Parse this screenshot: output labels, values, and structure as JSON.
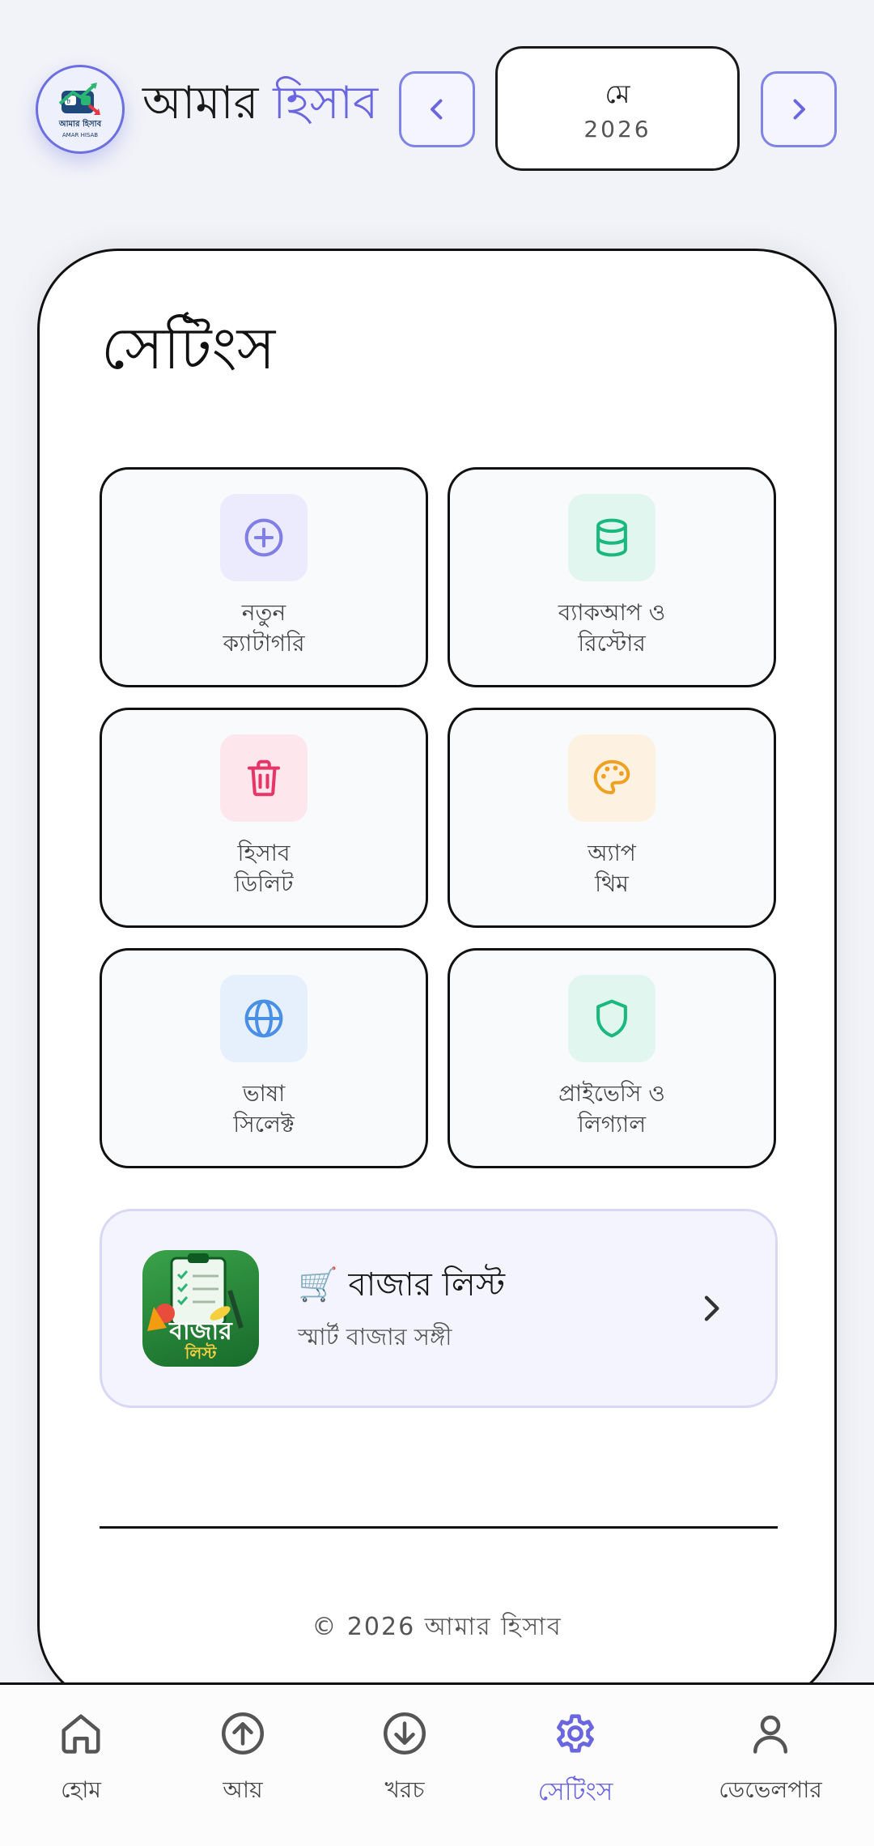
{
  "header": {
    "logo_text": "আমার হিসাব",
    "logo_subtext": "AMAR HISAB",
    "title_part1": "আমার",
    "title_part2": "হিসাব",
    "month": "মে",
    "year": "2026",
    "prev_icon": "chevron-left-icon",
    "next_icon": "chevron-right-icon"
  },
  "settings": {
    "title": "সেটিংস",
    "tiles": [
      {
        "line1": "নতুন",
        "line2": "ক্যাটাগরি",
        "icon": "plus-circle-icon",
        "color": "#7f7fe6",
        "bg": "#ecebfd"
      },
      {
        "line1": "ব্যাকআপ ও",
        "line2": "রিস্টোর",
        "icon": "database-icon",
        "color": "#1ab87e",
        "bg": "#e1f6ee"
      },
      {
        "line1": "হিসাব",
        "line2": "ডিলিট",
        "icon": "trash-icon",
        "color": "#e63566",
        "bg": "#fde6ec"
      },
      {
        "line1": "অ্যাপ",
        "line2": "থিম",
        "icon": "palette-icon",
        "color": "#f0a020",
        "bg": "#fdf1e2"
      },
      {
        "line1": "ভাষা",
        "line2": "সিলেক্ট",
        "icon": "globe-icon",
        "color": "#4a8fe6",
        "bg": "#e6effc"
      },
      {
        "line1": "প্রাইভেসি ও",
        "line2": "লিগ্যাল",
        "icon": "shield-icon",
        "color": "#1ab87e",
        "bg": "#e1f6ee"
      }
    ]
  },
  "promo": {
    "title": "🛒 বাজার লিস্ট",
    "subtitle": "স্মার্ট বাজার সঙ্গী",
    "image_text_1": "বাজার",
    "image_text_2": "লিস্ট"
  },
  "footer": {
    "copyright": "© 2026 আমার হিসাব"
  },
  "bottom_nav": {
    "items": [
      {
        "label": "হোম",
        "icon": "home-icon"
      },
      {
        "label": "আয়",
        "icon": "arrow-up-circle-icon"
      },
      {
        "label": "খরচ",
        "icon": "arrow-down-circle-icon"
      },
      {
        "label": "সেটিংস",
        "icon": "gear-icon"
      },
      {
        "label": "ডেভেলপার",
        "icon": "user-icon"
      }
    ],
    "active_index": 3,
    "active_color": "#6a66e0"
  }
}
